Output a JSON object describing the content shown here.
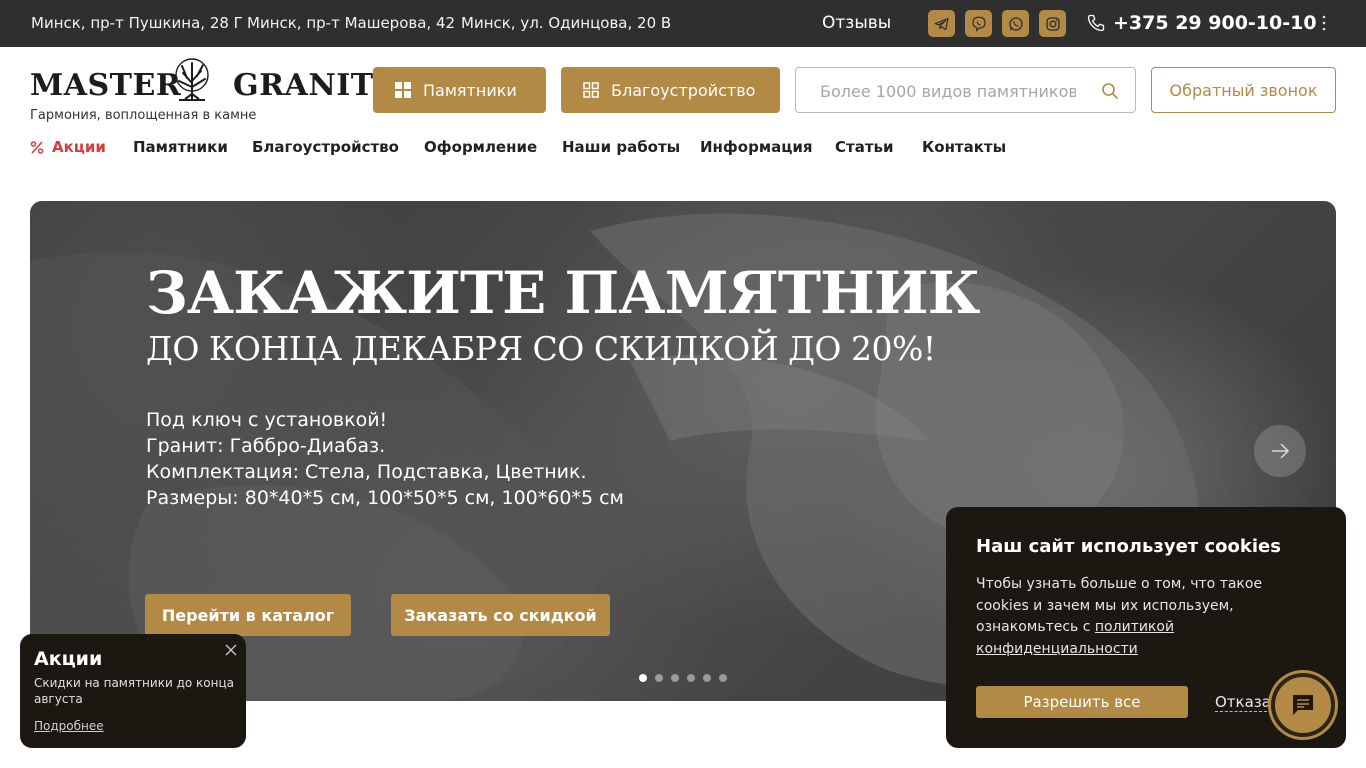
{
  "topbar": {
    "addresses": [
      "Минск, пр-т Пушкина, 28 Г",
      "Минск, пр-т Машерова, 42",
      "Минск, ул. Одинцова, 20 В"
    ],
    "reviews_label": "Отзывы",
    "socials": [
      "telegram-icon",
      "viber-icon",
      "whatsapp-icon",
      "instagram-icon"
    ],
    "phone": "+375 29 900-10-10"
  },
  "header": {
    "logo_left": "MASTER",
    "logo_right": "GRANIT",
    "tagline": "Гармония, воплощенная в камне",
    "btn_monuments": "Памятники",
    "btn_landscaping": "Благоустройство",
    "search_placeholder": "Более 1000 видов памятников",
    "callback": "Обратный звонок"
  },
  "nav": {
    "items": [
      "Акции",
      "Памятники",
      "Благоустройство",
      "Оформление",
      "Наши работы",
      "Информация",
      "Статьи",
      "Контакты"
    ]
  },
  "hero": {
    "title": "ЗАКАЖИТЕ ПАМЯТНИК",
    "subtitle": "ДО КОНЦА ДЕКАБРЯ СО СКИДКОЙ ДО 20%!",
    "lines": [
      "Под ключ с установкой!",
      "Гранит: Габбро-Диабаз.",
      "Комплектация: Стела, Подставка, Цветник.",
      "Размеры: 80*40*5 см, 100*50*5 см, 100*60*5 см"
    ],
    "btn_catalog": "Перейти в каталог",
    "btn_order": "Заказать со скидкой",
    "slide_count": 6,
    "active_slide": 1
  },
  "promo": {
    "title": "Акции",
    "desc": "Скидки на памятники до конца августа",
    "link": "Подробнее"
  },
  "cookie": {
    "title": "Наш сайт использует cookies",
    "body": "Чтобы узнать больше о том, что такое cookies и зачем мы их используем, ознакомьтесь с",
    "link": "политикой конфиденциальности",
    "allow": "Разрешить все",
    "deny": "Отказаться"
  },
  "colors": {
    "accent": "#b38a45",
    "sale": "#d93c3c",
    "topbar": "#2f2f2f",
    "dark_panel": "#1c1710"
  }
}
